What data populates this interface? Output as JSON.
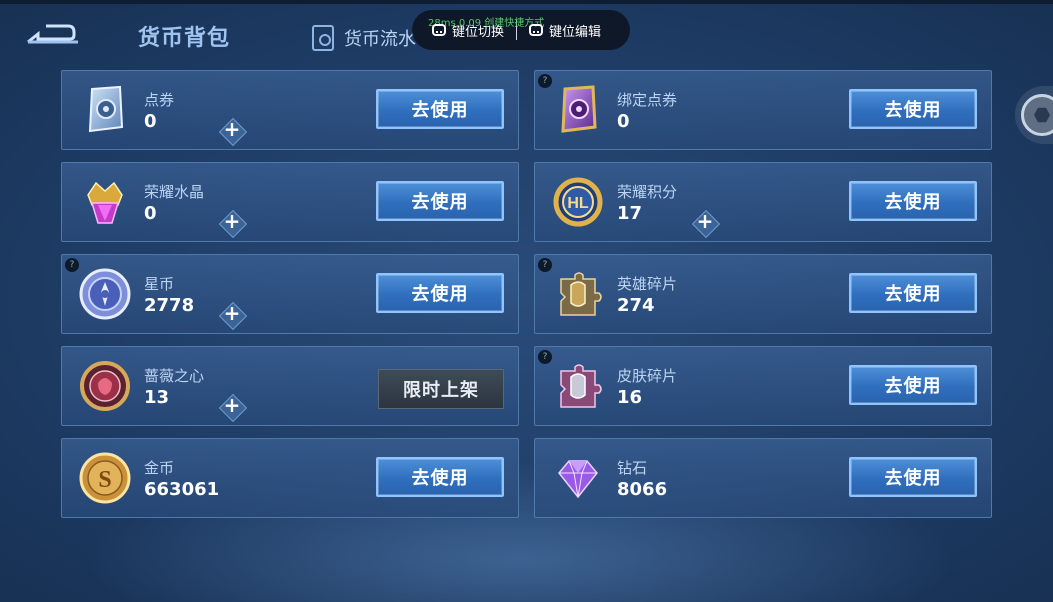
{
  "header": {
    "title": "货币背包",
    "flow_tab": "货币流水"
  },
  "overlay": {
    "stats": "28ms  0.09  创建快捷方式",
    "key_switch": "键位切换",
    "key_edit": "键位编辑"
  },
  "currencies": [
    {
      "name": "点券",
      "amount": "0",
      "action": "去使用",
      "has_plus": true
    },
    {
      "name": "绑定点券",
      "amount": "0",
      "action": "去使用",
      "has_plus": false
    },
    {
      "name": "荣耀水晶",
      "amount": "0",
      "action": "去使用",
      "has_plus": true
    },
    {
      "name": "荣耀积分",
      "amount": "17",
      "action": "去使用",
      "has_plus": true
    },
    {
      "name": "星币",
      "amount": "2778",
      "action": "去使用",
      "has_plus": true
    },
    {
      "name": "英雄碎片",
      "amount": "274",
      "action": "去使用",
      "has_plus": false
    },
    {
      "name": "蔷薇之心",
      "amount": "13",
      "action": "限时上架",
      "has_plus": true
    },
    {
      "name": "皮肤碎片",
      "amount": "16",
      "action": "去使用",
      "has_plus": false
    },
    {
      "name": "金币",
      "amount": "663061",
      "action": "去使用",
      "has_plus": false
    },
    {
      "name": "钻石",
      "amount": "8066",
      "action": "去使用",
      "has_plus": false
    }
  ],
  "icons": {
    "back": "back-arrow-icon",
    "flow": "ledger-icon",
    "settings": "hex-settings-icon"
  },
  "colors": {
    "accent_button": "#3a7cc8",
    "card_bg": "#30557f",
    "title": "#9fc3ef"
  }
}
